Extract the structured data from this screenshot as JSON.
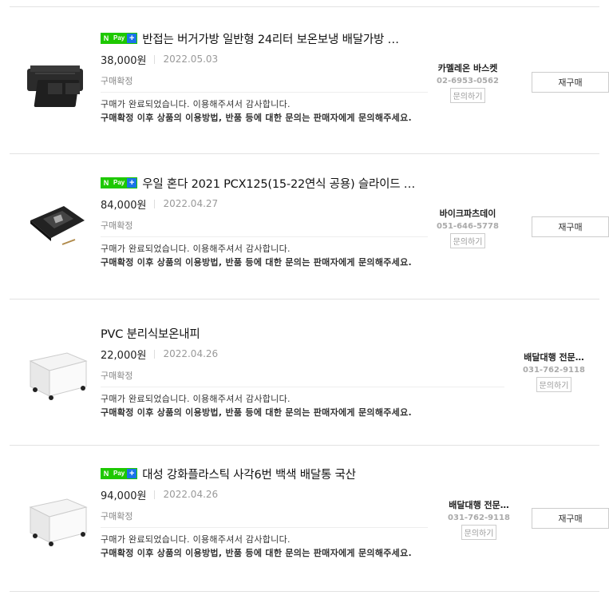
{
  "orders": [
    {
      "npay": true,
      "title": "반접는 버거가방 일반형 24리터 보온보냉 배달가방 …",
      "price": "38,000원",
      "date": "2022.05.03",
      "status": "구매확정",
      "message_line1": "구매가 완료되었습니다. 이용해주셔서 감사합니다.",
      "message_line2": "구매확정 이후 상품의 이용방법, 반품 등에 대한 문의는 판매자에게 문의해주세요.",
      "seller_name": "카멜레온 바스켓",
      "seller_phone": "02-6953-0562",
      "inquiry_label": "문의하기",
      "rebuy_label": "재구매",
      "thumb_icon": "delivery-bag-icon"
    },
    {
      "npay": true,
      "title": "우일 혼다 2021 PCX125(15-22연식 공용) 슬라이드 …",
      "price": "84,000원",
      "date": "2022.04.27",
      "status": "구매확정",
      "message_line1": "구매가 완료되었습니다. 이용해주셔서 감사합니다.",
      "message_line2": "구매확정 이후 상품의 이용방법, 반품 등에 대한 문의는 판매자에게 문의해주세요.",
      "seller_name": "바이크파츠데이",
      "seller_phone": "051-646-5778",
      "inquiry_label": "문의하기",
      "rebuy_label": "재구매",
      "thumb_icon": "slide-bracket-icon"
    },
    {
      "npay": false,
      "title": "PVC 분리식보온내피",
      "price": "22,000원",
      "date": "2022.04.26",
      "status": "구매확정",
      "message_line1": "구매가 완료되었습니다. 이용해주셔서 감사합니다.",
      "message_line2": "구매확정 이후 상품의 이용방법, 반품 등에 대한 문의는 판매자에게 문의해주세요.",
      "seller_name": "배달대행 전문…",
      "seller_phone": "031-762-9118",
      "inquiry_label": "문의하기",
      "rebuy_label": "",
      "thumb_icon": "white-box-icon"
    },
    {
      "npay": true,
      "title": "대성 강화플라스틱 사각6번 백색 배달통 국산",
      "price": "94,000원",
      "date": "2022.04.26",
      "status": "구매확정",
      "message_line1": "구매가 완료되었습니다. 이용해주셔서 감사합니다.",
      "message_line2": "구매확정 이후 상품의 이용방법, 반품 등에 대한 문의는 판매자에게 문의해주세요.",
      "seller_name": "배달대행 전문…",
      "seller_phone": "031-762-9118",
      "inquiry_label": "문의하기",
      "rebuy_label": "재구매",
      "thumb_icon": "white-box-icon"
    }
  ],
  "npay_badge": {
    "n": "N",
    "pay": "Pay",
    "plus": "+"
  },
  "colors": {
    "npay_green": "#1ec800",
    "npay_plus_blue": "#1a73e8",
    "divider": "#e2e2e2"
  }
}
